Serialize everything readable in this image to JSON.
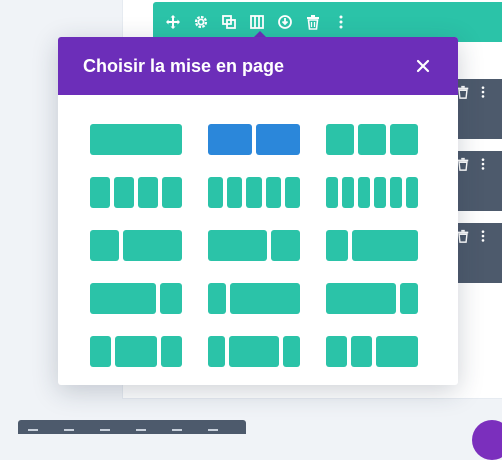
{
  "modal": {
    "title": "Choisir la mise en page",
    "close_icon": "close-icon",
    "header_color": "#6c2eb9"
  },
  "row_toolbar": {
    "color": "#2bc3a8",
    "icons": [
      "move-icon",
      "settings-icon",
      "duplicate-icon",
      "columns-icon",
      "save-icon",
      "delete-icon",
      "more-icon"
    ]
  },
  "side_bars": {
    "icons": [
      "delete-icon",
      "more-icon"
    ]
  },
  "layouts": {
    "accent": "#2bc3a8",
    "selected_color": "#2b87da",
    "selected_index": 1,
    "options": [
      {
        "name": "1 colonne",
        "cols": [
          1
        ]
      },
      {
        "name": "1/2 + 1/2",
        "cols": [
          1,
          1
        ]
      },
      {
        "name": "1/3 + 1/3 + 1/3",
        "cols": [
          1,
          1,
          1
        ]
      },
      {
        "name": "4 x 1/4",
        "cols": [
          1,
          1,
          1,
          1
        ]
      },
      {
        "name": "5 x 1/5",
        "cols": [
          1,
          1,
          1,
          1,
          1
        ]
      },
      {
        "name": "6 x 1/6",
        "cols": [
          1,
          1,
          1,
          1,
          1,
          1
        ]
      },
      {
        "name": "1/3 + 2/3",
        "cols": [
          1,
          2
        ]
      },
      {
        "name": "2/3 + 1/3",
        "cols": [
          2,
          1
        ]
      },
      {
        "name": "1/4 + 3/4",
        "cols": [
          1,
          3
        ]
      },
      {
        "name": "3/4 + 1/4",
        "cols": [
          3,
          1
        ]
      },
      {
        "name": "1/5 + 4/5",
        "cols": [
          1,
          4
        ]
      },
      {
        "name": "4/5 + 1/5",
        "cols": [
          4,
          1
        ]
      },
      {
        "name": "1/4 + 1/2 + 1/4",
        "cols": [
          1,
          2,
          1
        ]
      },
      {
        "name": "1/5 + 3/5 + 1/5",
        "cols": [
          1,
          3,
          1
        ]
      },
      {
        "name": "1/4 + 1/4 + 1/2",
        "cols": [
          1,
          1,
          2
        ]
      }
    ]
  }
}
